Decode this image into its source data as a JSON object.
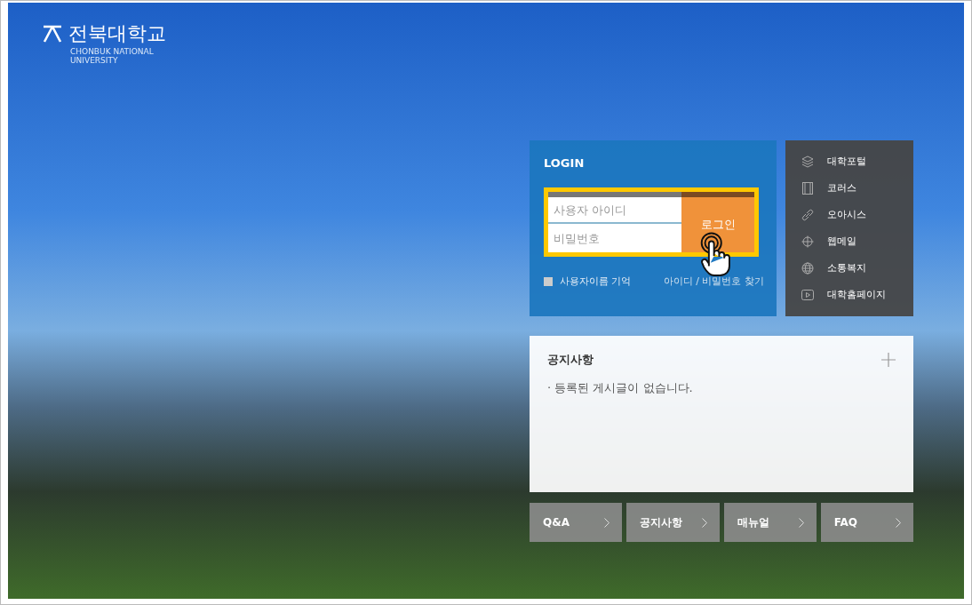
{
  "logo": {
    "name": "전북대학교",
    "subtitle": [
      "CHONBUK NATIONAL",
      "UNIVERSITY"
    ]
  },
  "login": {
    "title": "LOGIN",
    "id_placeholder": "사용자 아이디",
    "password_placeholder": "비밀번호",
    "button": "로그인",
    "remember": {
      "label": "사용자이름 기억",
      "checked": false
    },
    "find_link": "아이디 / 비밀번호 찾기"
  },
  "quick_links": [
    {
      "label": "대학포털",
      "kind": "layers"
    },
    {
      "label": "코러스",
      "kind": "film"
    },
    {
      "label": "오아시스",
      "kind": "link"
    },
    {
      "label": "웹메일",
      "kind": "crosshair"
    },
    {
      "label": "소통복지",
      "kind": "globe"
    },
    {
      "label": "대학홈페이지",
      "kind": "play"
    }
  ],
  "notice": {
    "title": "공지사항",
    "items": [
      "· 등록된 게시글이 없습니다."
    ]
  },
  "shortcuts": [
    {
      "label": "Q&A"
    },
    {
      "label": "공지사항"
    },
    {
      "label": "매뉴얼"
    },
    {
      "label": "FAQ"
    }
  ]
}
